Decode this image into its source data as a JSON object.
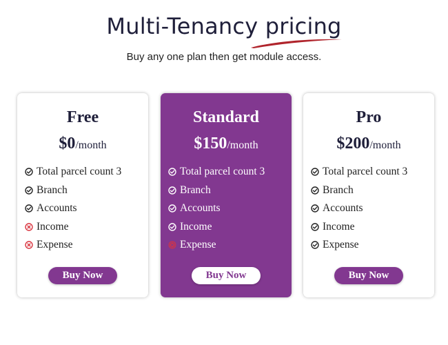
{
  "header": {
    "title": "Multi-Tenancy pricing",
    "subtitle": "Buy any one plan then get module access.",
    "accent_color": "#b0242c"
  },
  "plans": [
    {
      "name": "Free",
      "price": "$0",
      "period": "/month",
      "button_label": "Buy Now",
      "featured": false,
      "features": [
        {
          "label": "Total parcel count 3",
          "included": true
        },
        {
          "label": "Branch",
          "included": true
        },
        {
          "label": "Accounts",
          "included": true
        },
        {
          "label": "Income",
          "included": false
        },
        {
          "label": "Expense",
          "included": false
        }
      ]
    },
    {
      "name": "Standard",
      "price": "$150",
      "period": "/month",
      "button_label": "Buy Now",
      "featured": true,
      "features": [
        {
          "label": "Total parcel count 3",
          "included": true
        },
        {
          "label": "Branch",
          "included": true
        },
        {
          "label": "Accounts",
          "included": true
        },
        {
          "label": "Income",
          "included": true
        },
        {
          "label": "Expense",
          "included": false
        }
      ]
    },
    {
      "name": "Pro",
      "price": "$200",
      "period": "/month",
      "button_label": "Buy Now",
      "featured": false,
      "features": [
        {
          "label": "Total parcel count 3",
          "included": true
        },
        {
          "label": "Branch",
          "included": true
        },
        {
          "label": "Accounts",
          "included": true
        },
        {
          "label": "Income",
          "included": true
        },
        {
          "label": "Expense",
          "included": true
        }
      ]
    }
  ],
  "colors": {
    "brand": "#823890",
    "check_dark": "#222222",
    "cross": "#d9343f"
  }
}
